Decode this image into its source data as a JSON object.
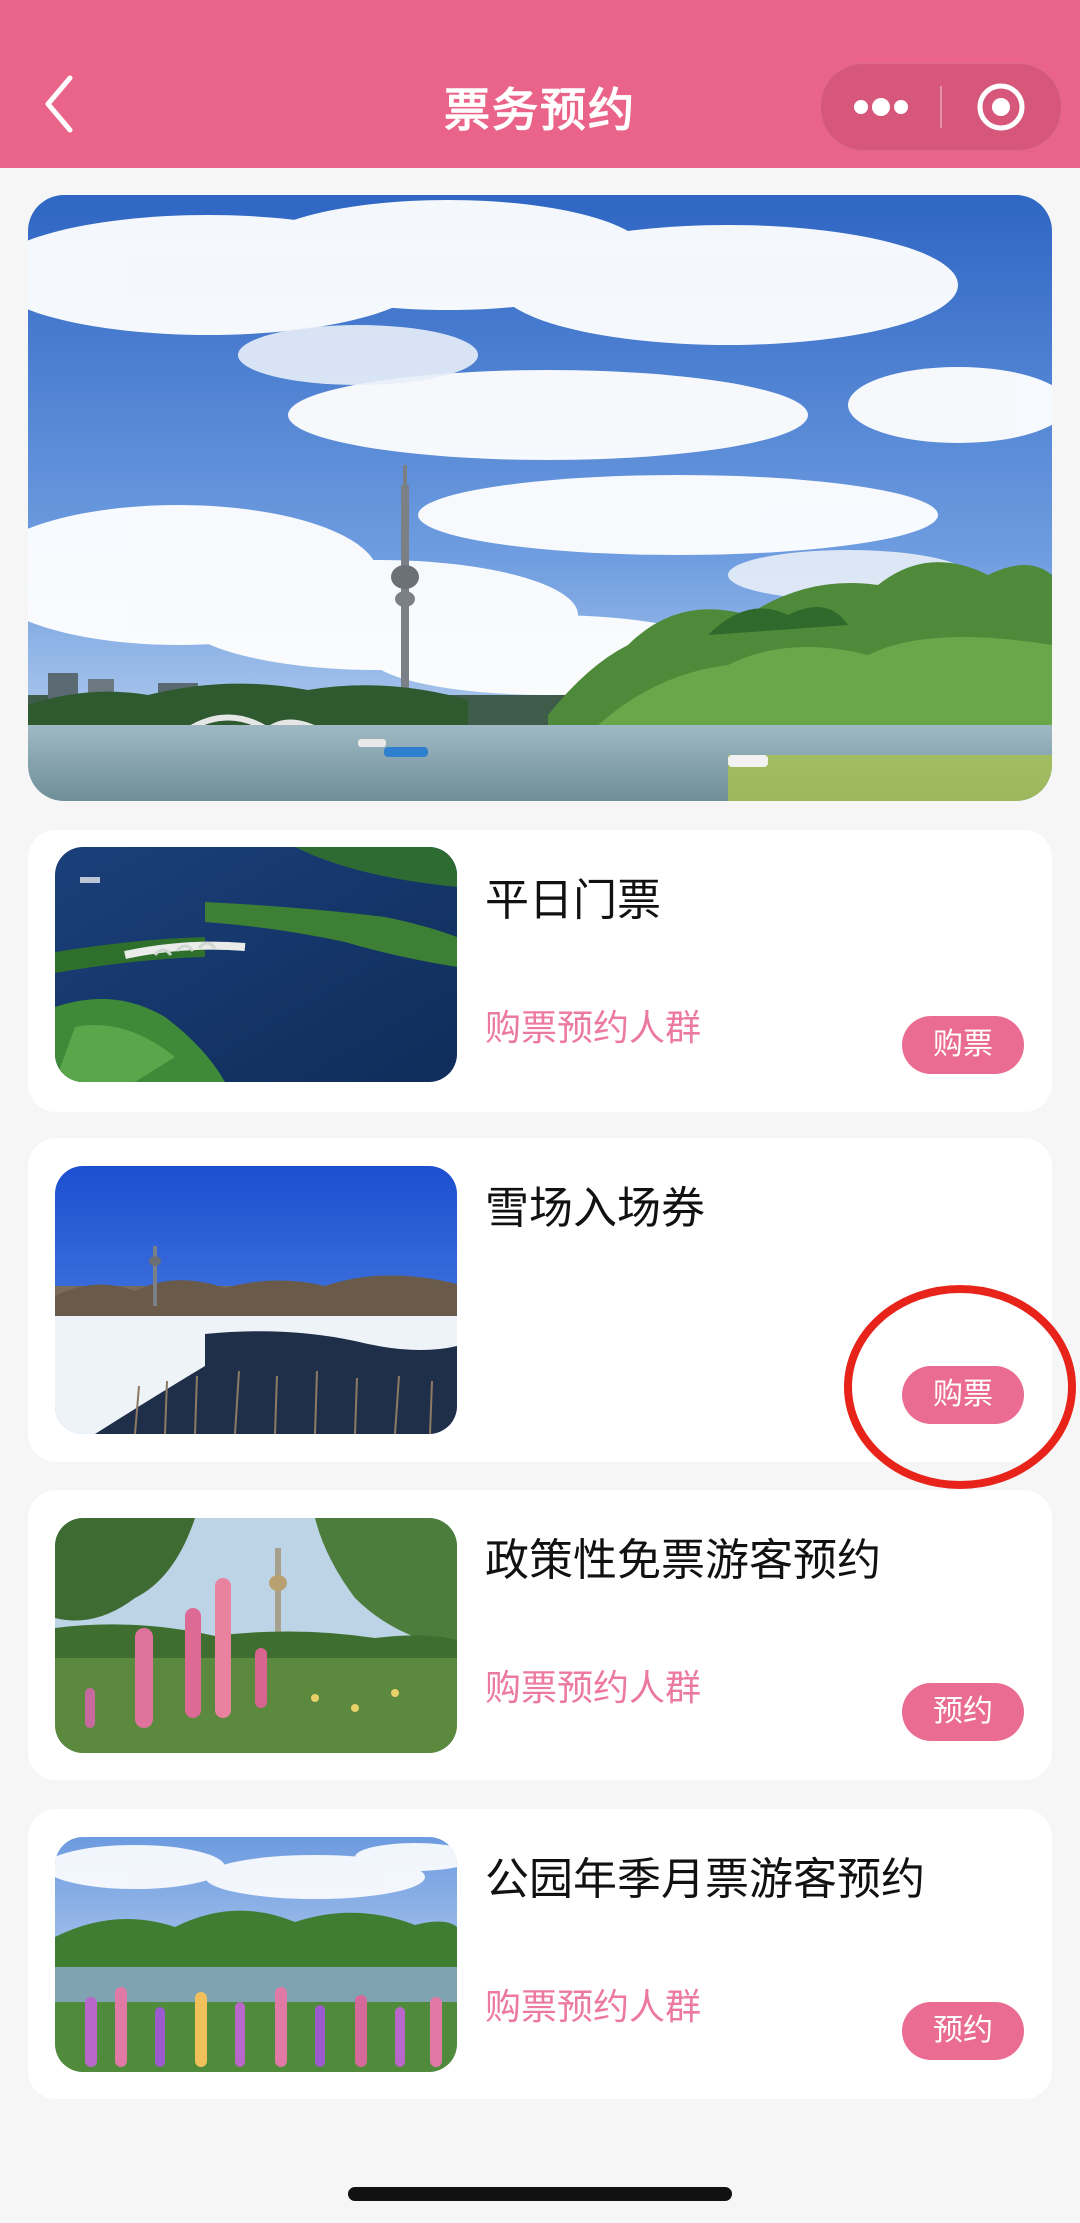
{
  "header": {
    "title": "票务预约",
    "back_icon": "chevron-left-icon",
    "more_icon": "more-dots-icon",
    "close_icon": "target-icon",
    "bg_color": "#ea6489"
  },
  "tickets": [
    {
      "title": "平日门票",
      "subtitle": "购票预约人群",
      "button": "购票"
    },
    {
      "title": "雪场入场券",
      "subtitle": "",
      "button": "购票"
    },
    {
      "title": "政策性免票游客预约",
      "subtitle": "购票预约人群",
      "button": "预约"
    },
    {
      "title": "公园年季月票游客预约",
      "subtitle": "购票预约人群",
      "button": "预约"
    }
  ],
  "colors": {
    "accent": "#ea6c92",
    "subtitle": "#ec79a0",
    "annotation": "#e8231a"
  }
}
